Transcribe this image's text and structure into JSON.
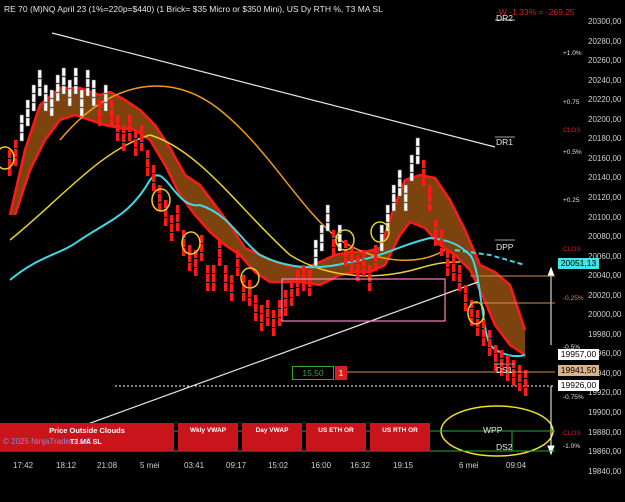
{
  "header": {
    "title": "RE 70 (M)NQ April 23 (1%=220p=$440) (1 Brick= $35 Micro or $350 Mini), US Dy RTH %, T3 MA SL",
    "pnl": "-W -1.33% = -269.25"
  },
  "price_axis": {
    "ticks": [
      "20300,00",
      "20280,00",
      "20260,00",
      "20240,00",
      "20220,00",
      "20200,00",
      "20180,00",
      "20160,00",
      "20140,00",
      "20120,00",
      "20100,00",
      "20080,00",
      "20060,00",
      "20040,00",
      "20020,00",
      "20000,00",
      "19980,00",
      "19960,00",
      "19940,00",
      "19920,00",
      "19900,00",
      "19880,00",
      "19860,00",
      "19840,00"
    ],
    "tags": [
      {
        "label": "20051,13",
        "bg": "#3fe6e6",
        "fg": "#000000"
      },
      {
        "label": "19957,00",
        "bg": "#ffffff",
        "fg": "#000000"
      },
      {
        "label": "19941,50",
        "bg": "#d9b38c",
        "fg": "#000000"
      },
      {
        "label": "19926,00",
        "bg": "#ffffff",
        "fg": "#000000"
      }
    ]
  },
  "time_axis": [
    "17:42",
    "18:12",
    "21:08",
    "5 mei",
    "03:41",
    "09:17",
    "15:02",
    "16:00",
    "16:32",
    "19:15",
    "6 mei",
    "09:04"
  ],
  "levels": [
    "DR2",
    "DR1",
    "DPP",
    "DS1",
    "WPP",
    "DS2"
  ],
  "percent_labels": [
    "+1.0%",
    "+0.75",
    "+0.5%",
    "+0.25",
    "-0.25%",
    "-0.5%",
    "-0.75%",
    "-1.0%",
    "CLOS",
    "CLOS",
    "CLOS"
  ],
  "order_box": {
    "price": "15,50",
    "qty": "1"
  },
  "bottom_panel": {
    "buttons": [
      "Price Outside Clouds",
      "Wkly VWAP",
      "Day VWAP",
      "US ETH OR",
      "US RTH OR"
    ],
    "sub_label": "T3 MA SL"
  },
  "copyright": "© 2025 NinjaTrader, LLC",
  "colors": {
    "background": "#000000",
    "cloud": "#8b4a10",
    "cloud_edge": "#ff1a1a",
    "cyan_ma": "#3fd8e6",
    "yellow_ma": "#e6d22a",
    "orange_ma": "#f09a1a",
    "up_brick": "#ffffff",
    "down_brick": "#ff1a1a"
  }
}
